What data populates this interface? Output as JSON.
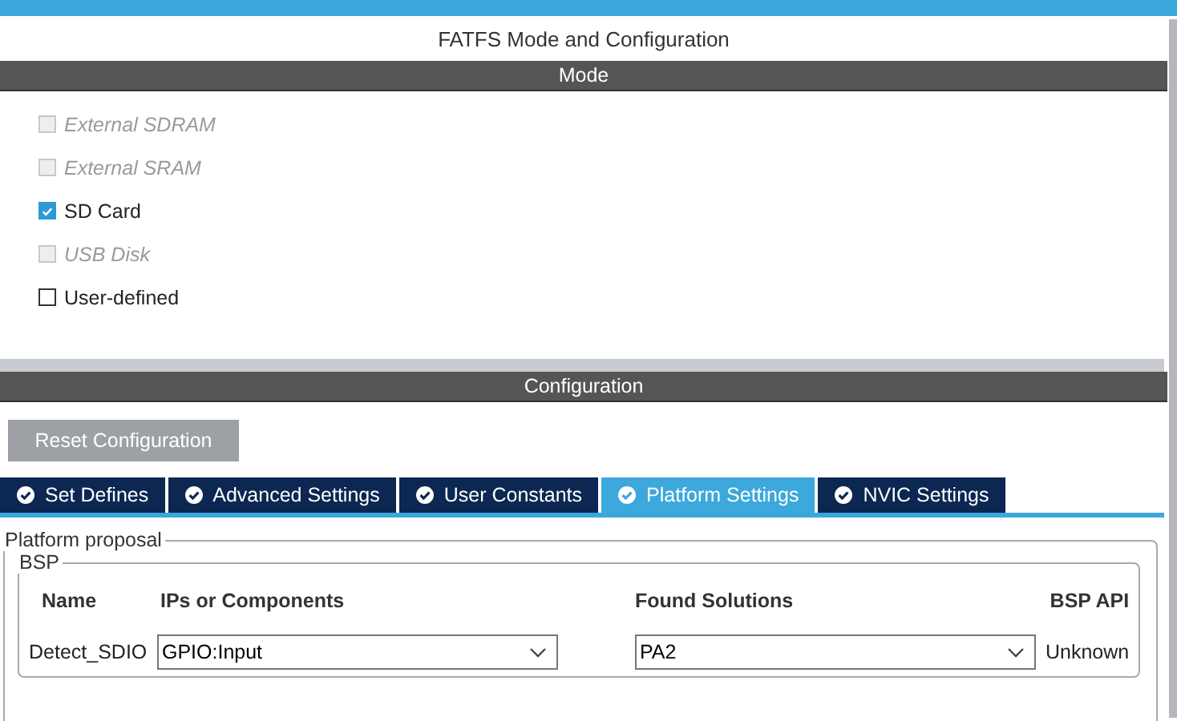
{
  "title": "FATFS Mode and Configuration",
  "mode": {
    "header": "Mode",
    "options": [
      {
        "label": "External SDRAM",
        "checked": false,
        "disabled": true
      },
      {
        "label": "External SRAM",
        "checked": false,
        "disabled": true
      },
      {
        "label": "SD Card",
        "checked": true,
        "disabled": false
      },
      {
        "label": "USB Disk",
        "checked": false,
        "disabled": true
      },
      {
        "label": "User-defined",
        "checked": false,
        "disabled": false
      }
    ]
  },
  "configuration": {
    "header": "Configuration",
    "reset_button": "Reset Configuration",
    "tabs": [
      {
        "label": "Set Defines",
        "selected": false
      },
      {
        "label": "Advanced Settings",
        "selected": false
      },
      {
        "label": "User Constants",
        "selected": false
      },
      {
        "label": "Platform Settings",
        "selected": true
      },
      {
        "label": "NVIC Settings",
        "selected": false
      }
    ],
    "platform_proposal": {
      "legend": "Platform proposal",
      "bsp": {
        "legend": "BSP",
        "columns": [
          "Name",
          "IPs or Components",
          "Found Solutions",
          "BSP API"
        ],
        "rows": [
          {
            "name": "Detect_SDIO",
            "component": "GPIO:Input",
            "solution": "PA2",
            "api": "Unknown"
          }
        ]
      }
    }
  }
}
